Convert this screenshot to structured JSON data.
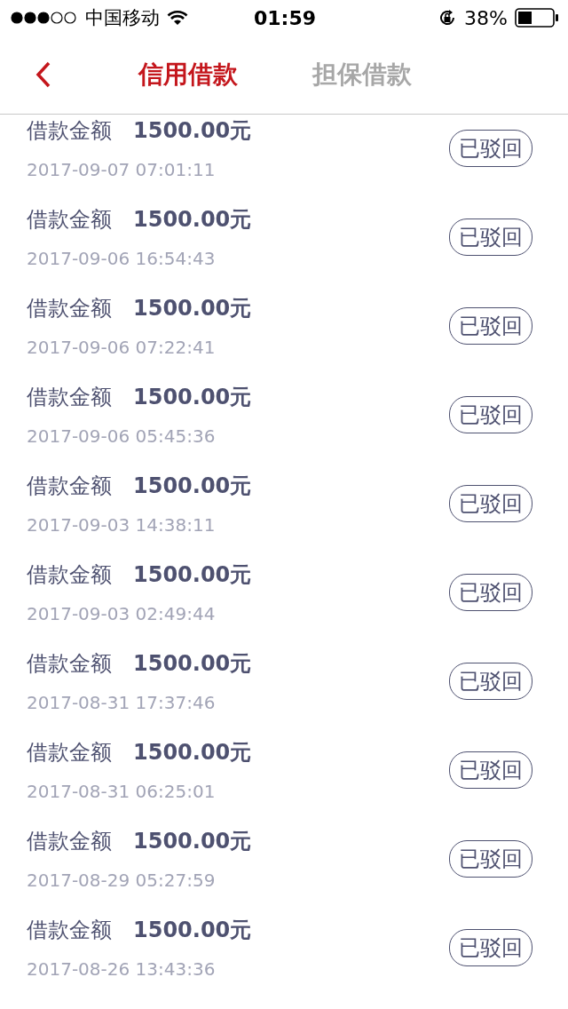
{
  "status_bar": {
    "carrier": "中国移动",
    "time": "01:59",
    "battery": "38%"
  },
  "tabs": [
    {
      "label": "信用借款",
      "selected": true
    },
    {
      "label": "担保借款",
      "selected": false
    }
  ],
  "records": [
    {
      "label": "借款金额",
      "amount": "1500.00元",
      "time": "2017-09-07 07:01:11",
      "status": "已驳回"
    },
    {
      "label": "借款金额",
      "amount": "1500.00元",
      "time": "2017-09-06 16:54:43",
      "status": "已驳回"
    },
    {
      "label": "借款金额",
      "amount": "1500.00元",
      "time": "2017-09-06 07:22:41",
      "status": "已驳回"
    },
    {
      "label": "借款金额",
      "amount": "1500.00元",
      "time": "2017-09-06 05:45:36",
      "status": "已驳回"
    },
    {
      "label": "借款金额",
      "amount": "1500.00元",
      "time": "2017-09-03 14:38:11",
      "status": "已驳回"
    },
    {
      "label": "借款金额",
      "amount": "1500.00元",
      "time": "2017-09-03 02:49:44",
      "status": "已驳回"
    },
    {
      "label": "借款金额",
      "amount": "1500.00元",
      "time": "2017-08-31 17:37:46",
      "status": "已驳回"
    },
    {
      "label": "借款金额",
      "amount": "1500.00元",
      "time": "2017-08-31 06:25:01",
      "status": "已驳回"
    },
    {
      "label": "借款金额",
      "amount": "1500.00元",
      "time": "2017-08-29 05:27:59",
      "status": "已驳回"
    },
    {
      "label": "借款金额",
      "amount": "1500.00元",
      "time": "2017-08-26 13:43:36",
      "status": "已驳回"
    }
  ]
}
